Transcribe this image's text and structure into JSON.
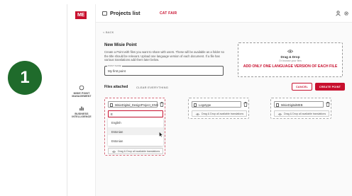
{
  "step_badge": {
    "number": "1"
  },
  "brand": {
    "logo_text": "ME",
    "accent_color": "#c8102e",
    "badge_color": "#1f6b2b"
  },
  "sidebar": {
    "items": [
      {
        "label_line1": "MISIE POINT",
        "label_line2": "MANAGEMENT",
        "icon": "circle-icon"
      },
      {
        "label_line1": "BUSINESS",
        "label_line2": "INTELLIGENCE",
        "icon": "bar-chart-icon"
      }
    ]
  },
  "header": {
    "title": "Projects list",
    "tag": "CAT FAIR",
    "icons": [
      "folder-icon",
      "user-icon",
      "gear-icon"
    ]
  },
  "main": {
    "back_label": "< BACK",
    "section_title": "New Misie Point",
    "description": "Create a Point with files you want to share with users. These will be available as a folder so the title should be relevant. Upload one language version of each document. If a file has various translations add them later below.",
    "name_field": {
      "label": "POINT NAME",
      "value": "My first point"
    },
    "dropzone": {
      "title": "Drag & Drop",
      "subtitle": "Or browse your files",
      "warning": "ADD ONLY ONE LANGUAGE VERSION OF EACH FILE"
    },
    "files_header": "Files attached",
    "clear_label": "CLEAR EVERYTHING",
    "cancel_label": "CANCEL",
    "create_label": "CREATE POINT",
    "files": [
      {
        "name": "MisieDigital_DesignProject_ENG",
        "drag_label": "Drag & Drop all available translations",
        "language_input": "E",
        "language_options": [
          "English",
          "Estonian",
          "Estonian"
        ]
      },
      {
        "name": "Logotype",
        "drag_label": "Drag & Drop all available translations"
      },
      {
        "name": "MisieDigitalMEB",
        "drag_label": "Drag & Drop all available translations"
      }
    ]
  }
}
